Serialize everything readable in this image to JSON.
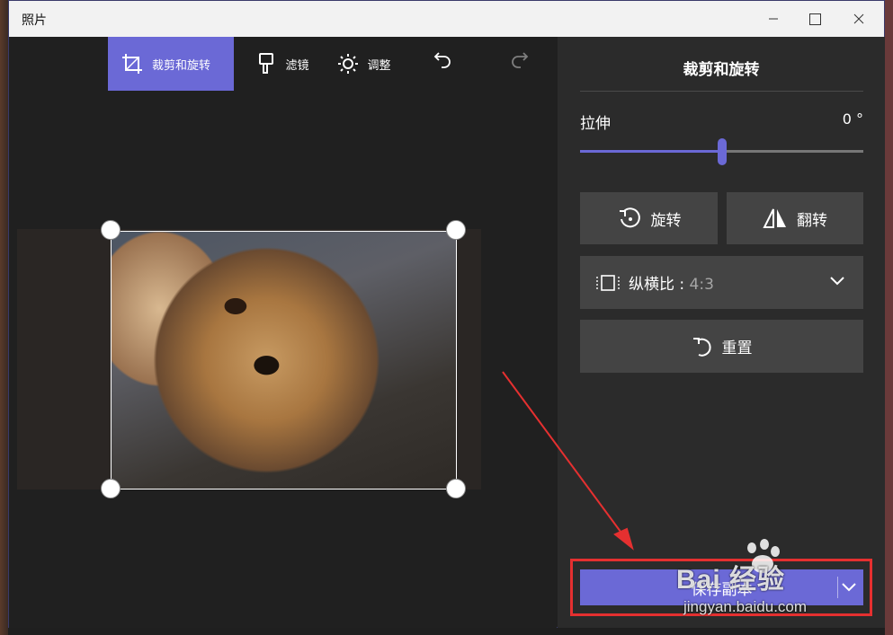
{
  "window": {
    "title": "照片"
  },
  "toolbar": {
    "crop_label": "裁剪和旋转",
    "filter_label": "滤镜",
    "adjust_label": "调整"
  },
  "panel": {
    "title": "裁剪和旋转",
    "stretch_label": "拉伸",
    "stretch_value": "0 °",
    "stretch_position": 0.5,
    "rotate_label": "旋转",
    "flip_label": "翻转",
    "aspect_label": "纵横比 : ",
    "aspect_value": "4:3",
    "reset_label": "重置",
    "save_label": "保存副本"
  },
  "watermark": {
    "brand": "Bai 经验",
    "url": "jingyan.baidu.com"
  },
  "colors": {
    "accent": "#6b69d6",
    "annotation": "#e53030"
  }
}
